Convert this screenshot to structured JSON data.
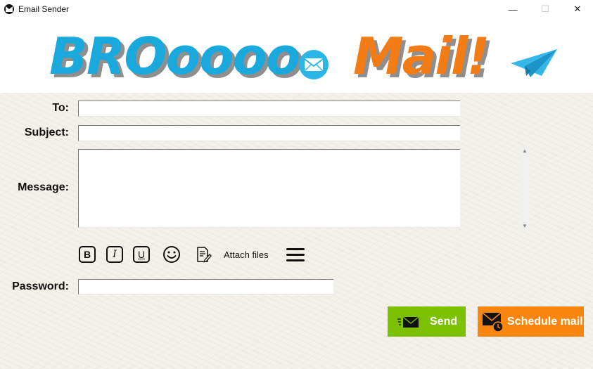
{
  "window": {
    "title": "Email Sender",
    "controls": {
      "minimize": "—",
      "maximize": "☐",
      "close": "✕"
    }
  },
  "logo": {
    "part1": "BROoooo",
    "part2": "Mail!",
    "colors": {
      "part1": "#1aa9dd",
      "part2": "#f47c14",
      "shadow": "#8f8f8f"
    },
    "icons": [
      "envelope-icon",
      "paper-plane-icon"
    ]
  },
  "form": {
    "to_label": "To:",
    "to_value": "",
    "subject_label": "Subject:",
    "subject_value": "",
    "message_label": "Message:",
    "message_value": "",
    "password_label": "Password:",
    "password_value": ""
  },
  "toolbar": {
    "bold": "B",
    "italic": "I",
    "underline": "U",
    "emoji_icon": "smiley-icon",
    "attach_icon": "document-pen-icon",
    "attach_label": "Attach files",
    "menu_icon": "hamburger-menu-icon"
  },
  "actions": {
    "send_label": "Send",
    "schedule_label": "Schedule mail",
    "colors": {
      "send": "#7cc000",
      "schedule": "#f9870f"
    }
  }
}
